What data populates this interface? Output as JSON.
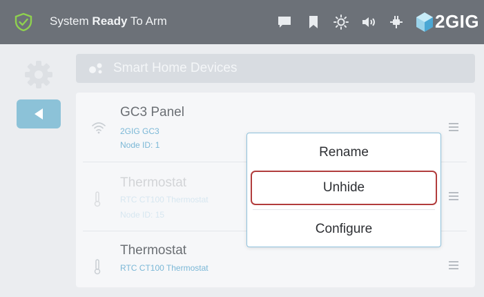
{
  "status_bar": {
    "status_prefix": "System",
    "status_bold": "Ready",
    "status_suffix": "To Arm",
    "brand": "2GIG",
    "icons": [
      "message-icon",
      "bookmark-icon",
      "brightness-icon",
      "volume-icon",
      "power-plug-icon"
    ]
  },
  "section": {
    "title": "Smart Home Devices"
  },
  "devices": [
    {
      "name": "GC3 Panel",
      "model": "2GIG GC3",
      "node": "Node ID: 1",
      "icon": "wifi-icon",
      "faded": false
    },
    {
      "name": "Thermostat",
      "model": "RTC CT100 Thermostat",
      "node": "Node ID: 15",
      "icon": "thermometer-icon",
      "faded": true
    },
    {
      "name": "Thermostat",
      "model": "RTC CT100 Thermostat",
      "node": "",
      "icon": "thermometer-icon",
      "faded": false
    }
  ],
  "context_menu": {
    "items": [
      "Rename",
      "Unhide",
      "Configure"
    ],
    "highlighted": "Unhide"
  },
  "colors": {
    "topbar": "#6c7178",
    "accent_blue": "#7ab7d6",
    "shield_green": "#8fd14f",
    "highlight_border": "#b13b3b",
    "back_button": "#8cc2d8"
  }
}
